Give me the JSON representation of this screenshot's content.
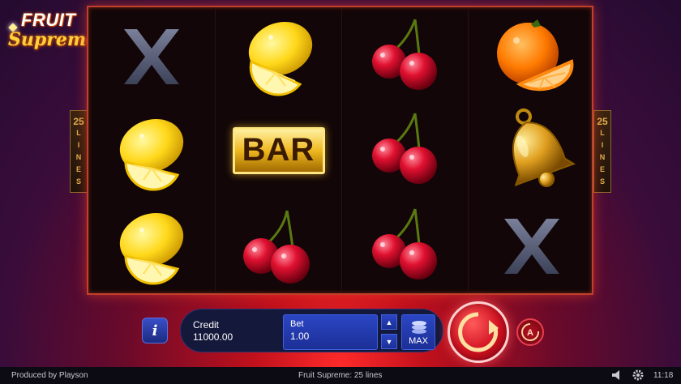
{
  "logo": {
    "line1": "FRUIT",
    "line2": "Supreme"
  },
  "lines_badge": {
    "number": "25",
    "letters": [
      "L",
      "I",
      "N",
      "E",
      "S"
    ]
  },
  "reels": [
    [
      "x-symbol",
      "lemon",
      "lemon"
    ],
    [
      "lemon",
      "bar",
      "cherries"
    ],
    [
      "cherries",
      "cherries",
      "cherries"
    ],
    [
      "orange",
      "bell",
      "x-symbol"
    ]
  ],
  "bar_text": "BAR",
  "controls": {
    "info_label": "i",
    "credit_label": "Credit",
    "credit_value": "11000.00",
    "bet_label": "Bet",
    "bet_value": "1.00",
    "max_label": "MAX",
    "auto_label": "A"
  },
  "footer": {
    "produced_by": "Produced by Playson",
    "game_lines": "Fruit Supreme: 25 lines",
    "time": "11:18"
  },
  "colors": {
    "frame": "#c2402b",
    "panel": "#14183a",
    "bet_blue": "#2b46c4",
    "spin_red": "#d01020"
  }
}
